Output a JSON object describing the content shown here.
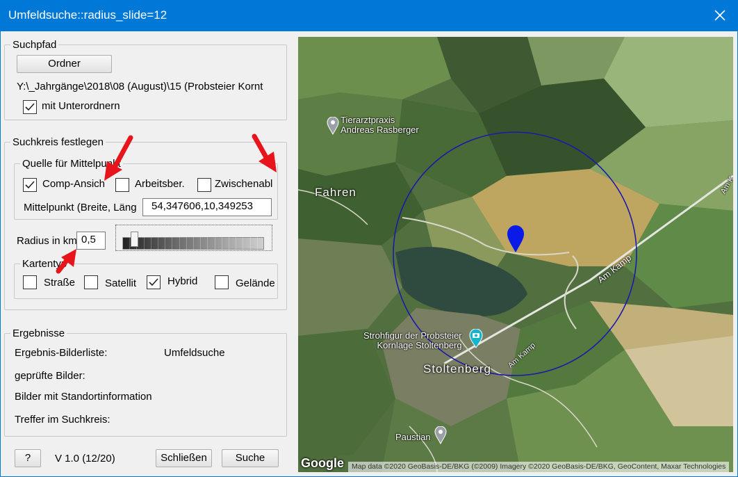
{
  "window": {
    "title": "Umfeldsuche::radius_slide=12"
  },
  "suchpfad": {
    "legend": "Suchpfad",
    "ordner_button": "Ordner",
    "path": "Y:\\_Jahrgänge\\2018\\08 (August)\\15 (Probsteier Kornt",
    "subfolders_label": "mit Unterordnern",
    "subfolders_checked": true
  },
  "suchkreis": {
    "legend": "Suchkreis festlegen",
    "quelle": {
      "legend": "Quelle für Mittelpunkt",
      "options": [
        {
          "label": "Comp-Ansich",
          "checked": true
        },
        {
          "label": "Arbeitsber.",
          "checked": false
        },
        {
          "label": "Zwischenabl",
          "checked": false
        }
      ],
      "mittelpunkt_label": "Mittelpunkt (Breite, Läng",
      "mittelpunkt_value": "54,347606,10,349253"
    },
    "radius_label": "Radius in km",
    "radius_value": "0,5",
    "slider_position": 0.06,
    "kartentyp": {
      "legend": "Kartentyp",
      "options": [
        {
          "label": "Straße",
          "checked": false
        },
        {
          "label": "Satellit",
          "checked": false
        },
        {
          "label": "Hybrid",
          "checked": true
        },
        {
          "label": "Gelände",
          "checked": false
        }
      ]
    }
  },
  "ergebnisse": {
    "legend": "Ergebnisse",
    "rows": [
      {
        "label": "Ergebnis-Bilderliste:",
        "value": "Umfeldsuche"
      },
      {
        "label": "geprüfte Bilder:",
        "value": ""
      },
      {
        "label": "Bilder mit Standortinformation",
        "value": ""
      },
      {
        "label": "Treffer im Suchkreis:",
        "value": ""
      }
    ]
  },
  "footer": {
    "help_button": "?",
    "version": "V 1.0 (12/20)",
    "close_button": "Schließen",
    "search_button": "Suche"
  },
  "map": {
    "labels": {
      "tierarzt": [
        "Tierarztpraxis",
        "Andreas Rasberger"
      ],
      "fahren": "Fahren",
      "strohfigur": [
        "Strohfigur der Probsteier",
        "Kornlage Stoltenberg"
      ],
      "stoltenberg": "Stoltenberg",
      "paustian": "Paustian",
      "am_kamp_1": "Am Kamp",
      "am_kamp_2": "Am Kamp",
      "am_kamp_3": "Am K"
    },
    "attribution": "Map data ©2020 GeoBasis-DE/BKG (©2009) Imagery ©2020 GeoBasis-DE/BKG, GeoContent, Maxar Technologies",
    "logo": "Google",
    "accent_colors": {
      "circle": "#1a1aa8",
      "marker": "#0a1be8",
      "annotation": "#e8141c"
    }
  }
}
